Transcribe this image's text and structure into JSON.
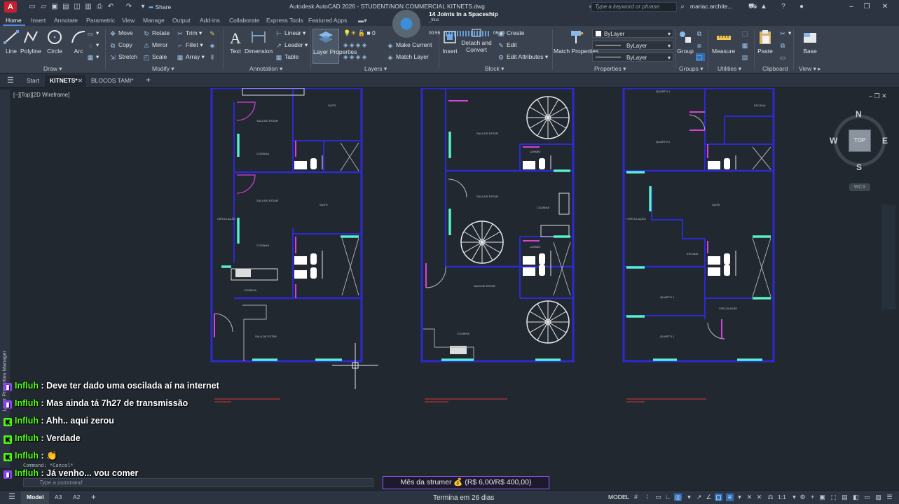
{
  "app": {
    "logo_letter": "A",
    "window_title": "Autodesk AutoCAD 2026 - STUDENT/NON COMMERCIAL    KITNETS.dwg",
    "share_label": "Share",
    "search_placeholder": "Type a keyword or phrase",
    "user_name": "mariac.archite..."
  },
  "music": {
    "title": "14 Joints In a Spaceship",
    "artist": "_titus",
    "time_elapsed": "00:55",
    "time_total": "05:40"
  },
  "ribbon_tabs": [
    "Home",
    "Insert",
    "Annotate",
    "Parametric",
    "View",
    "Manage",
    "Output",
    "Add-ins",
    "Collaborate",
    "Express Tools",
    "Featured Apps"
  ],
  "ribbon": {
    "draw": {
      "line": "Line",
      "polyline": "Polyline",
      "circle": "Circle",
      "arc": "Arc",
      "panel": "Draw"
    },
    "modify": {
      "move": "Move",
      "rotate": "Rotate",
      "trim": "Trim",
      "copy": "Copy",
      "mirror": "Mirror",
      "fillet": "Fillet",
      "stretch": "Stretch",
      "scale": "Scale",
      "array": "Array",
      "panel": "Modify"
    },
    "annotation": {
      "text": "Text",
      "dimension": "Dimension",
      "linear": "Linear",
      "leader": "Leader",
      "table": "Table",
      "panel": "Annotation"
    },
    "layers": {
      "layer_properties": "Layer Properties",
      "layer_value": "0",
      "make_current": "Make Current",
      "match_layer": "Match Layer",
      "panel": "Layers"
    },
    "block": {
      "insert": "Insert",
      "create": "Create",
      "edit": "Edit",
      "detach_convert": "Detach and Convert",
      "edit_attributes": "Edit Attributes",
      "panel": "Block"
    },
    "properties": {
      "match_properties": "Match Properties",
      "color": "ByLayer",
      "linetype": "ByLayer",
      "lineweight": "ByLayer",
      "panel": "Properties"
    },
    "groups": {
      "group": "Group",
      "panel": "Groups"
    },
    "utilities": {
      "measure": "Measure",
      "panel": "Utilities"
    },
    "clipboard": {
      "paste": "Paste",
      "panel": "Clipboard"
    },
    "view": {
      "base": "Base",
      "panel": "View"
    }
  },
  "file_tabs": {
    "start": "Start",
    "kitnets": "KITNETS*",
    "blocos": "BLOCOS TAMI*"
  },
  "viewport_label": "[−][Top][2D Wireframe]",
  "side_palette_label": "Layer Properties Manager",
  "viewcube": {
    "north": "N",
    "south": "S",
    "east": "E",
    "west": "W",
    "top": "TOP",
    "wcs": "WCS"
  },
  "chat": [
    {
      "badge": "twitch",
      "user": "Influh",
      "message": "Deve ter dado uma oscilada aí na internet"
    },
    {
      "badge": "twitch",
      "user": "Influh",
      "message": "Mas ainda tá 7h27 de transmissão"
    },
    {
      "badge": "kick",
      "user": "Influh",
      "message": "Ahh.. aqui zerou"
    },
    {
      "badge": "kick",
      "user": "Influh",
      "message": "Verdade"
    },
    {
      "badge": "kick",
      "user": "Influh",
      "message": "👏"
    },
    {
      "badge": "twitch",
      "user": "Influh",
      "message": "Já venho... vou comer"
    }
  ],
  "command": {
    "history": "Command: *Cancel*",
    "placeholder": "Type a command"
  },
  "sub_goal": "Mês da strumer 💰 (R$ 6,00/R$ 400,00)",
  "sub_ends": "Termina em 26 dias",
  "statusbar": {
    "model": "Model",
    "layout1": "A3",
    "layout2": "A2",
    "model_space": "MODEL",
    "scale": "1:1"
  },
  "colors": {
    "wall": "#2c2ad0",
    "door": "#d643d6",
    "window": "#57f0c8",
    "accent": "#4a8ad6",
    "chat_user": "#53fc18"
  }
}
